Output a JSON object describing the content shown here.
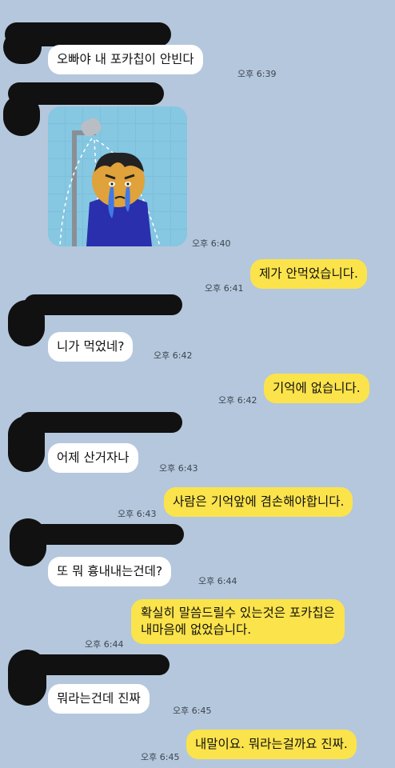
{
  "chat": {
    "messages": [
      {
        "side": "in",
        "text": "오빠야 내 포카칩이 안빈다",
        "time": "오후 6:39"
      },
      {
        "side": "in",
        "type": "sticker",
        "icon": "crying-shower-sticker",
        "time": "오후 6:40"
      },
      {
        "side": "out",
        "text": "제가 안먹었습니다.",
        "time": "오후 6:41"
      },
      {
        "side": "in",
        "text": "니가 먹었네?",
        "time": "오후 6:42"
      },
      {
        "side": "out",
        "text": "기억에 없습니다.",
        "time": "오후 6:42"
      },
      {
        "side": "in",
        "text": "어제 산거자나",
        "time": "오후 6:43"
      },
      {
        "side": "out",
        "text": "사람은 기억앞에 겸손해야합니다.",
        "time": "오후 6:43"
      },
      {
        "side": "in",
        "text": "또 뭐 흉내내는건데?",
        "time": "오후 6:44"
      },
      {
        "side": "out",
        "lines": [
          "확실히 말씀드릴수 있는것은 포카칩은",
          "내마음에 없었습니다."
        ],
        "time": "오후 6:44"
      },
      {
        "side": "in",
        "text": "뭐라는건데 진짜",
        "time": "오후 6:45"
      },
      {
        "side": "out",
        "text": "내말이요. 뭐라는걸까요 진짜.",
        "time": "오후 6:45"
      }
    ]
  },
  "colors": {
    "background": "#b5c7dc",
    "incoming_bubble": "#ffffff",
    "outgoing_bubble": "#fbe34b",
    "redaction": "#111111"
  }
}
